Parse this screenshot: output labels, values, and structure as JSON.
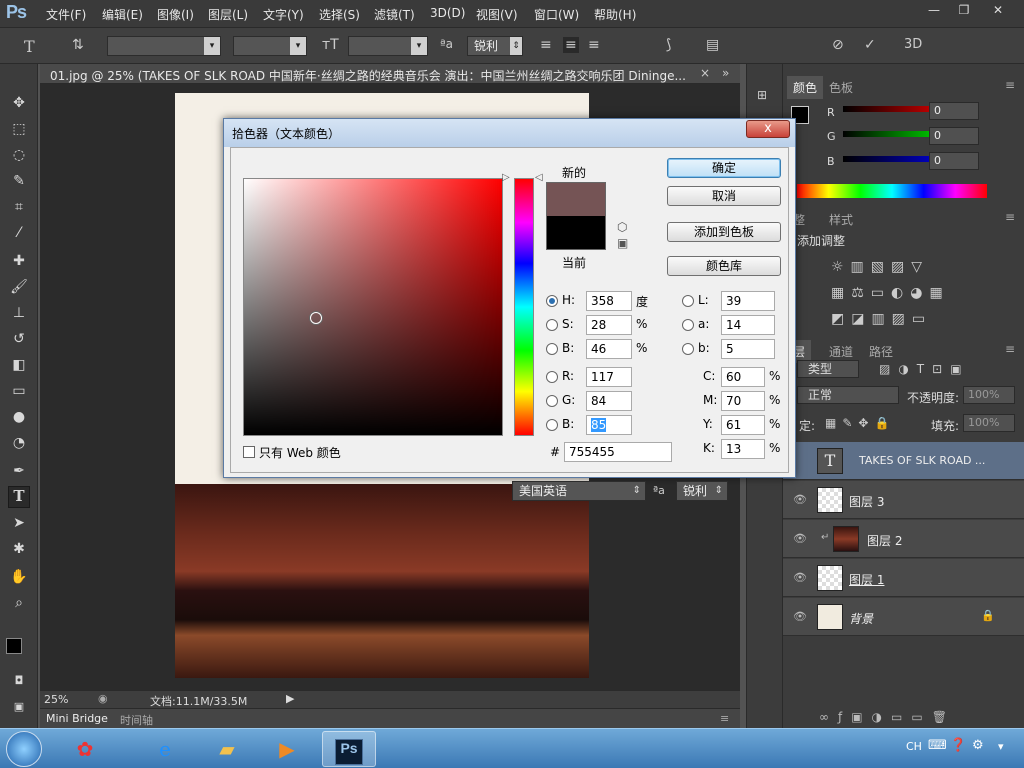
{
  "app": {
    "logo": "Ps",
    "menu": [
      "文件(F)",
      "编辑(E)",
      "图像(I)",
      "图层(L)",
      "文字(Y)",
      "选择(S)",
      "滤镜(T)",
      "3D(D)",
      "视图(V)",
      "窗口(W)",
      "帮助(H)"
    ]
  },
  "options": {
    "antialias": "锐利",
    "three_d": "3D"
  },
  "document": {
    "tab_title": "01.jpg @ 25% (TAKES  OF  SLK  ROAD 中国新年·丝绸之路的经典音乐会 演出：中国兰州丝绸之路交响乐团 Dininge...",
    "zoom": "25%",
    "doc_size": "文档:11.1M/33.5M",
    "language": "美国英语",
    "antialias": "锐利"
  },
  "bottom_tabs": [
    "Mini Bridge",
    "时间轴"
  ],
  "color_panel": {
    "tabs": [
      "颜色",
      "色板"
    ],
    "r_label": "R",
    "g_label": "G",
    "b_label": "B",
    "r": "0",
    "g": "0",
    "b": "0"
  },
  "adjust_panel": {
    "tabs": [
      "整",
      "样式"
    ],
    "title": "添加调整"
  },
  "layers_panel": {
    "tabs": [
      "层",
      "通道",
      "路径"
    ],
    "filter_label": "类型",
    "blend_mode": "正常",
    "opacity_label": "不透明度:",
    "opacity": "100%",
    "lock_label": "定:",
    "fill_label": "填充:",
    "fill": "100%",
    "layers": [
      {
        "name": "TAKES OF SLK ROAD ...",
        "type": "text",
        "selected": true
      },
      {
        "name": "图层 3",
        "type": "layer"
      },
      {
        "name": "图层 2",
        "type": "clipped"
      },
      {
        "name": "图层 1",
        "type": "layer"
      },
      {
        "name": "背景",
        "type": "background",
        "locked": true
      }
    ]
  },
  "dialog": {
    "title": "拾色器（文本颜色）",
    "close": "x",
    "new_label": "新的",
    "current_label": "当前",
    "new_color": "#755455",
    "current_color": "#000000",
    "ok": "确定",
    "cancel": "取消",
    "add_swatch": "添加到色板",
    "color_lib": "颜色库",
    "web_only": "只有 Web 颜色",
    "hsb": {
      "h_label": "H:",
      "h": "358",
      "h_unit": "度",
      "s_label": "S:",
      "s": "28",
      "s_unit": "%",
      "b_label": "B:",
      "b": "46",
      "b_unit": "%"
    },
    "rgb": {
      "r_label": "R:",
      "r": "117",
      "g_label": "G:",
      "g": "84",
      "b_label": "B:",
      "b": "85"
    },
    "lab": {
      "l_label": "L:",
      "l": "39",
      "a_label": "a:",
      "a": "14",
      "b_label": "b:",
      "b": "5"
    },
    "cmyk": {
      "c_label": "C:",
      "c": "60",
      "m_label": "M:",
      "m": "70",
      "y_label": "Y:",
      "y": "61",
      "k_label": "K:",
      "k": "13",
      "unit": "%"
    },
    "hex_label": "#",
    "hex": "755455"
  },
  "taskbar": {
    "ps_label": "Ps",
    "lang": "CH"
  }
}
